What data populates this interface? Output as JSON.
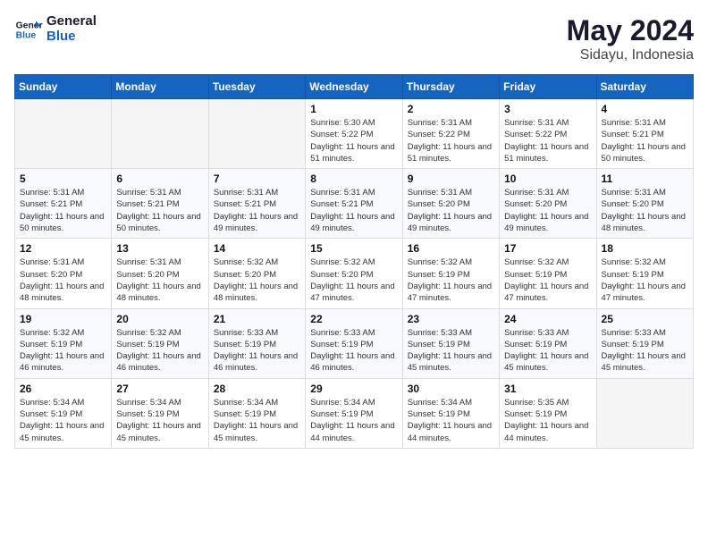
{
  "header": {
    "logo_line1": "General",
    "logo_line2": "Blue",
    "month": "May 2024",
    "location": "Sidayu, Indonesia"
  },
  "days_of_week": [
    "Sunday",
    "Monday",
    "Tuesday",
    "Wednesday",
    "Thursday",
    "Friday",
    "Saturday"
  ],
  "weeks": [
    [
      {
        "day": "",
        "sunrise": "",
        "sunset": "",
        "daylight": ""
      },
      {
        "day": "",
        "sunrise": "",
        "sunset": "",
        "daylight": ""
      },
      {
        "day": "",
        "sunrise": "",
        "sunset": "",
        "daylight": ""
      },
      {
        "day": "1",
        "sunrise": "Sunrise: 5:30 AM",
        "sunset": "Sunset: 5:22 PM",
        "daylight": "Daylight: 11 hours and 51 minutes."
      },
      {
        "day": "2",
        "sunrise": "Sunrise: 5:31 AM",
        "sunset": "Sunset: 5:22 PM",
        "daylight": "Daylight: 11 hours and 51 minutes."
      },
      {
        "day": "3",
        "sunrise": "Sunrise: 5:31 AM",
        "sunset": "Sunset: 5:22 PM",
        "daylight": "Daylight: 11 hours and 51 minutes."
      },
      {
        "day": "4",
        "sunrise": "Sunrise: 5:31 AM",
        "sunset": "Sunset: 5:21 PM",
        "daylight": "Daylight: 11 hours and 50 minutes."
      }
    ],
    [
      {
        "day": "5",
        "sunrise": "Sunrise: 5:31 AM",
        "sunset": "Sunset: 5:21 PM",
        "daylight": "Daylight: 11 hours and 50 minutes."
      },
      {
        "day": "6",
        "sunrise": "Sunrise: 5:31 AM",
        "sunset": "Sunset: 5:21 PM",
        "daylight": "Daylight: 11 hours and 50 minutes."
      },
      {
        "day": "7",
        "sunrise": "Sunrise: 5:31 AM",
        "sunset": "Sunset: 5:21 PM",
        "daylight": "Daylight: 11 hours and 49 minutes."
      },
      {
        "day": "8",
        "sunrise": "Sunrise: 5:31 AM",
        "sunset": "Sunset: 5:21 PM",
        "daylight": "Daylight: 11 hours and 49 minutes."
      },
      {
        "day": "9",
        "sunrise": "Sunrise: 5:31 AM",
        "sunset": "Sunset: 5:20 PM",
        "daylight": "Daylight: 11 hours and 49 minutes."
      },
      {
        "day": "10",
        "sunrise": "Sunrise: 5:31 AM",
        "sunset": "Sunset: 5:20 PM",
        "daylight": "Daylight: 11 hours and 49 minutes."
      },
      {
        "day": "11",
        "sunrise": "Sunrise: 5:31 AM",
        "sunset": "Sunset: 5:20 PM",
        "daylight": "Daylight: 11 hours and 48 minutes."
      }
    ],
    [
      {
        "day": "12",
        "sunrise": "Sunrise: 5:31 AM",
        "sunset": "Sunset: 5:20 PM",
        "daylight": "Daylight: 11 hours and 48 minutes."
      },
      {
        "day": "13",
        "sunrise": "Sunrise: 5:31 AM",
        "sunset": "Sunset: 5:20 PM",
        "daylight": "Daylight: 11 hours and 48 minutes."
      },
      {
        "day": "14",
        "sunrise": "Sunrise: 5:32 AM",
        "sunset": "Sunset: 5:20 PM",
        "daylight": "Daylight: 11 hours and 48 minutes."
      },
      {
        "day": "15",
        "sunrise": "Sunrise: 5:32 AM",
        "sunset": "Sunset: 5:20 PM",
        "daylight": "Daylight: 11 hours and 47 minutes."
      },
      {
        "day": "16",
        "sunrise": "Sunrise: 5:32 AM",
        "sunset": "Sunset: 5:19 PM",
        "daylight": "Daylight: 11 hours and 47 minutes."
      },
      {
        "day": "17",
        "sunrise": "Sunrise: 5:32 AM",
        "sunset": "Sunset: 5:19 PM",
        "daylight": "Daylight: 11 hours and 47 minutes."
      },
      {
        "day": "18",
        "sunrise": "Sunrise: 5:32 AM",
        "sunset": "Sunset: 5:19 PM",
        "daylight": "Daylight: 11 hours and 47 minutes."
      }
    ],
    [
      {
        "day": "19",
        "sunrise": "Sunrise: 5:32 AM",
        "sunset": "Sunset: 5:19 PM",
        "daylight": "Daylight: 11 hours and 46 minutes."
      },
      {
        "day": "20",
        "sunrise": "Sunrise: 5:32 AM",
        "sunset": "Sunset: 5:19 PM",
        "daylight": "Daylight: 11 hours and 46 minutes."
      },
      {
        "day": "21",
        "sunrise": "Sunrise: 5:33 AM",
        "sunset": "Sunset: 5:19 PM",
        "daylight": "Daylight: 11 hours and 46 minutes."
      },
      {
        "day": "22",
        "sunrise": "Sunrise: 5:33 AM",
        "sunset": "Sunset: 5:19 PM",
        "daylight": "Daylight: 11 hours and 46 minutes."
      },
      {
        "day": "23",
        "sunrise": "Sunrise: 5:33 AM",
        "sunset": "Sunset: 5:19 PM",
        "daylight": "Daylight: 11 hours and 45 minutes."
      },
      {
        "day": "24",
        "sunrise": "Sunrise: 5:33 AM",
        "sunset": "Sunset: 5:19 PM",
        "daylight": "Daylight: 11 hours and 45 minutes."
      },
      {
        "day": "25",
        "sunrise": "Sunrise: 5:33 AM",
        "sunset": "Sunset: 5:19 PM",
        "daylight": "Daylight: 11 hours and 45 minutes."
      }
    ],
    [
      {
        "day": "26",
        "sunrise": "Sunrise: 5:34 AM",
        "sunset": "Sunset: 5:19 PM",
        "daylight": "Daylight: 11 hours and 45 minutes."
      },
      {
        "day": "27",
        "sunrise": "Sunrise: 5:34 AM",
        "sunset": "Sunset: 5:19 PM",
        "daylight": "Daylight: 11 hours and 45 minutes."
      },
      {
        "day": "28",
        "sunrise": "Sunrise: 5:34 AM",
        "sunset": "Sunset: 5:19 PM",
        "daylight": "Daylight: 11 hours and 45 minutes."
      },
      {
        "day": "29",
        "sunrise": "Sunrise: 5:34 AM",
        "sunset": "Sunset: 5:19 PM",
        "daylight": "Daylight: 11 hours and 44 minutes."
      },
      {
        "day": "30",
        "sunrise": "Sunrise: 5:34 AM",
        "sunset": "Sunset: 5:19 PM",
        "daylight": "Daylight: 11 hours and 44 minutes."
      },
      {
        "day": "31",
        "sunrise": "Sunrise: 5:35 AM",
        "sunset": "Sunset: 5:19 PM",
        "daylight": "Daylight: 11 hours and 44 minutes."
      },
      {
        "day": "",
        "sunrise": "",
        "sunset": "",
        "daylight": ""
      }
    ]
  ]
}
